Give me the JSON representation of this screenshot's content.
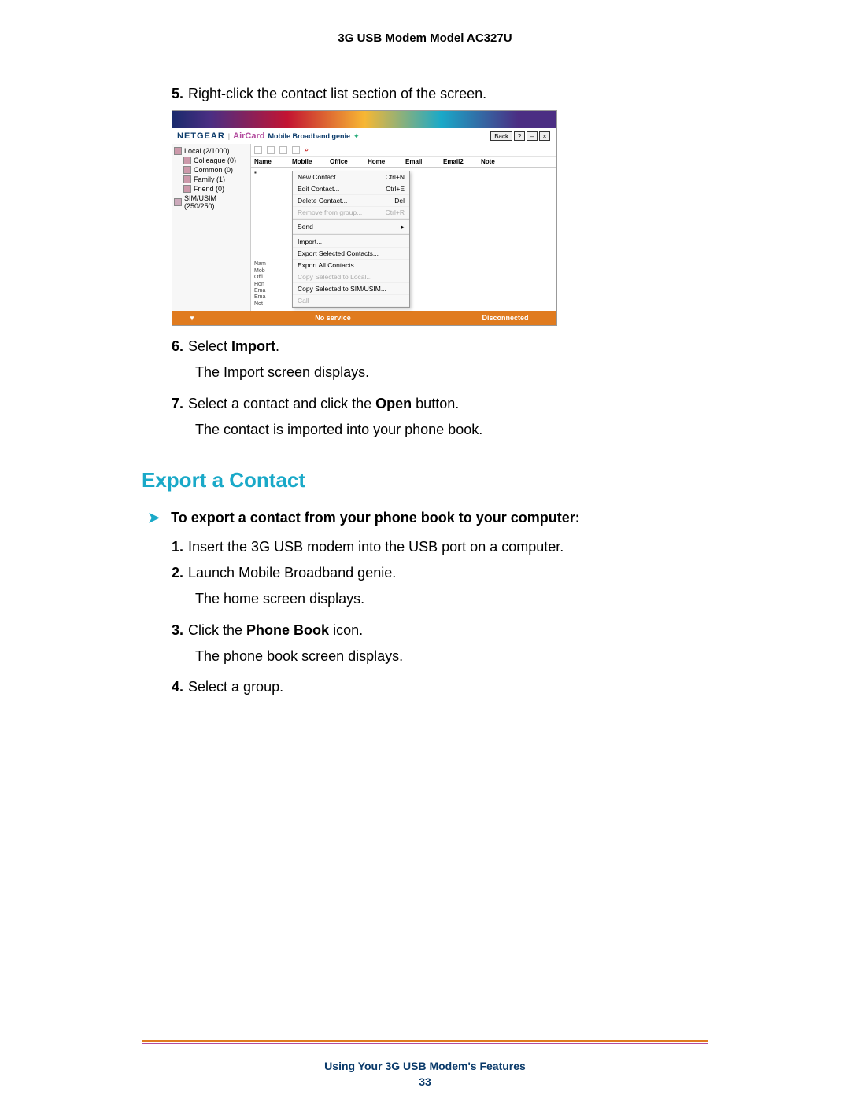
{
  "header": {
    "product": "3G USB Modem Model AC327U"
  },
  "steps_a": {
    "s5": {
      "num": "5.",
      "text": "Right-click the contact list section of the screen."
    },
    "s6": {
      "num": "6.",
      "pre": "Select ",
      "bold": "Import",
      "post": ".",
      "result": "The Import screen displays."
    },
    "s7": {
      "num": "7.",
      "pre": "Select a contact and click the ",
      "bold": "Open",
      "post": " button.",
      "result": "The contact is imported into your phone book."
    }
  },
  "h2": "Export a Contact",
  "task": "To export a contact from your phone book to your computer:",
  "steps_b": {
    "s1": {
      "num": "1.",
      "text": "Insert the 3G USB modem into the USB port on a computer."
    },
    "s2": {
      "num": "2.",
      "text": "Launch Mobile Broadband genie.",
      "result": "The home screen displays."
    },
    "s3": {
      "num": "3.",
      "pre": "Click the ",
      "bold": "Phone Book",
      "post": " icon.",
      "result": "The phone book screen displays."
    },
    "s4": {
      "num": "4.",
      "text": "Select a group."
    }
  },
  "fig": {
    "brand": {
      "netgear": "NETGEAR",
      "aircard": "AirCard",
      "mbg": "Mobile Broadband genie"
    },
    "hdr_btns": {
      "back": "Back",
      "help": "?",
      "min": "–",
      "close": "×"
    },
    "tree": {
      "root": "Local (2/1000)",
      "items": [
        "Colleague (0)",
        "Common (0)",
        "Family (1)",
        "Friend (0)"
      ],
      "sim": "SIM/USIM (250/250)"
    },
    "cols": [
      "Name",
      "Mobile",
      "Office",
      "Home",
      "Email",
      "Email2",
      "Note"
    ],
    "ctx": {
      "new": "New Contact...",
      "new_sc": "Ctrl+N",
      "edit": "Edit Contact...",
      "edit_sc": "Ctrl+E",
      "del": "Delete Contact...",
      "del_sc": "Del",
      "rem": "Remove from group...",
      "rem_sc": "Ctrl+R",
      "send": "Send",
      "import": "Import...",
      "expsel": "Export Selected Contacts...",
      "expall": "Export All Contacts...",
      "copylocal": "Copy Selected to Local...",
      "copysim": "Copy Selected to SIM/USIM...",
      "call": "Call"
    },
    "detail_labels": [
      "Nam",
      "Mob",
      "Offi",
      "Hon",
      "Ema",
      "Ema",
      "Not"
    ],
    "status": {
      "no_service": "No service",
      "disconnected": "Disconnected"
    }
  },
  "footer": {
    "chapter": "Using Your 3G USB Modem's Features",
    "page": "33"
  }
}
